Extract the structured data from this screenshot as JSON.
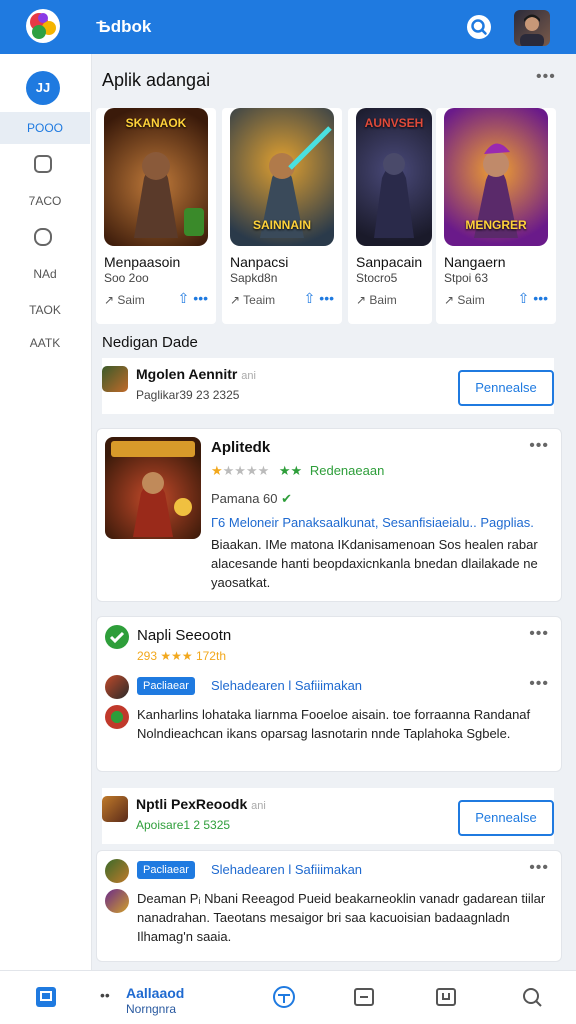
{
  "header": {
    "title": "Ѣdbok"
  },
  "sidebar": {
    "top_label": "JJ",
    "items": [
      {
        "label": "POOO",
        "active": true
      },
      {
        "label": "",
        "icon": "gamepad-icon"
      },
      {
        "label": "7ACO"
      },
      {
        "label": "",
        "icon": "dice-icon"
      },
      {
        "label": "NAd"
      },
      {
        "label": "TAOK"
      },
      {
        "label": "AATK"
      }
    ]
  },
  "featured_section": {
    "title": "Aplik adangai",
    "games": [
      {
        "art_label": "SKANAOK",
        "name": "Menpaasoin",
        "sub": "Soo 2oo",
        "action": "Saim",
        "art_color": "#6a3a1a"
      },
      {
        "art_label": "SAINNAIN",
        "name": "Nanpacsi",
        "sub": "Sapkd8n",
        "action": "Teaim",
        "art_color": "#2a6a8a"
      },
      {
        "art_label": "AUNVSEH",
        "name": "Sanpacain",
        "sub": "Stocro5",
        "action": "Baim",
        "art_color": "#2a2a5a"
      },
      {
        "art_label": "MENGRER",
        "name": "Nangaern",
        "sub": "Stpoi 63",
        "action": "Saim",
        "art_color": "#8a2a8a"
      }
    ]
  },
  "nedigan_section": {
    "title": "Nedigan Dade",
    "row": {
      "title": "Mgolen Aennitr",
      "title_suffix": "ani",
      "sub": "Paglikar39 23 2325",
      "button": "Pennealse"
    }
  },
  "app_card": {
    "title": "Aplitedk",
    "rating_text": "Redenaeaan",
    "meta": "Pamana 60",
    "links": "Г6 Meloneir Panaksaalkunat, Sesanfisiaeialu.. Pagplias.",
    "description": "Biaakan. IMe matona IKdanisamenoan Sos healen rabar alacesande hanti beopdaxicnkanla bnedan dlailakade ne yaosatkat."
  },
  "post_1": {
    "title": "Napli Seeootn",
    "rating": "293 ★★★ 172th",
    "tag": "Pacliaear",
    "tag_link": "Slehadearen l Safiiimakan",
    "body": "Kanharlins lohataka liarnma Fooeloe aisain. toe forraanna Randanaf Nolndieachcan ikans oparsag lasnotarin nnde Taplahoka Sgbele."
  },
  "row_2": {
    "title": "Nptli PexReoodk",
    "title_suffix": "ani",
    "sub": "Apoisare1 2 5325",
    "button": "Pennealse"
  },
  "post_2": {
    "tag": "Pacliaear",
    "tag_link": "Slehadearen l Safiiimakan",
    "body": "Deaman Pᵢ Nbani Reeagod Pueid beakarneoklin vanadr gadarean tiilar nanadrahan. Taeotans mesaigor bri saa kacuoisian badaagnladn Ilhamag'n saaia."
  },
  "bottom_nav": {
    "label_line1": "Aallaaod",
    "label_line2": "Norngnra"
  },
  "colors": {
    "brand": "#1f7ae0",
    "star": "#f2a81d",
    "positive": "#2e9e3a"
  }
}
